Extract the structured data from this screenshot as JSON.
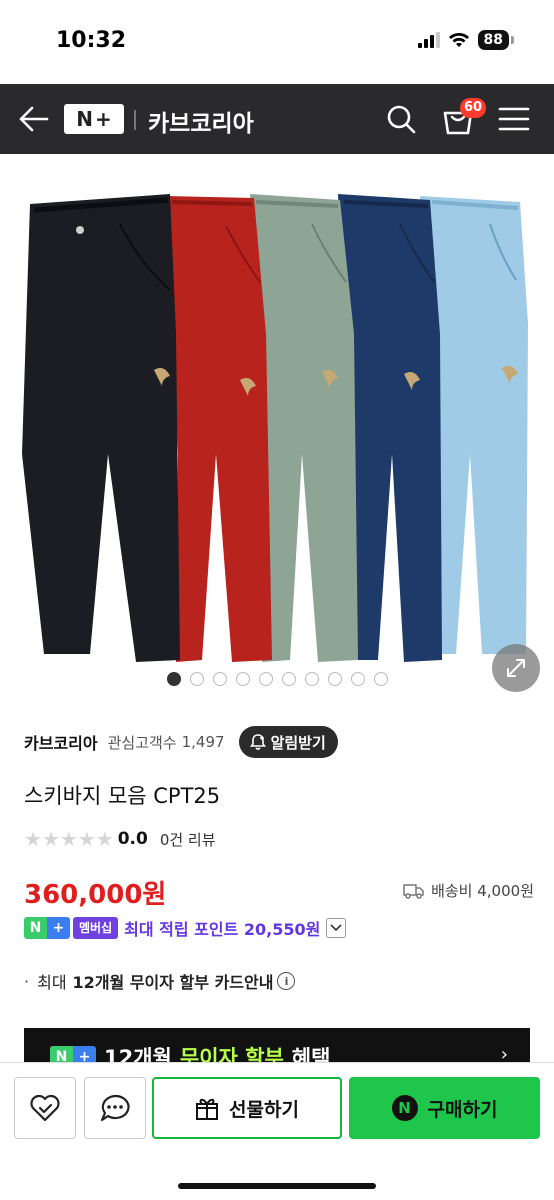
{
  "status_bar": {
    "time": "10:32",
    "battery": "88"
  },
  "header": {
    "store_title": "카브코리아",
    "logo_n": "N",
    "logo_plus": "+",
    "cart_count": "60"
  },
  "colors": {
    "header_bg": "#2a2a2c",
    "price_red": "#e01e1e",
    "naver_green": "#1ec74b",
    "member_purple": "#6f42e0",
    "pant_colors": [
      "#1b1d22",
      "#b8231d",
      "#8ea596",
      "#1e3a68",
      "#9fcbe6"
    ]
  },
  "carousel": {
    "dot_count": 10,
    "active_index": 0
  },
  "store": {
    "name": "카브코리아",
    "interest_label": "관심고객수",
    "interest_count": "1,497",
    "alert_label": "알림받기"
  },
  "product": {
    "title": "스키바지 모음 CPT25",
    "rating": "0.0",
    "review_count": "0건 리뷰",
    "price": "360,000원",
    "shipping": "배송비 4,000원"
  },
  "membership": {
    "nplus_n": "N",
    "nplus_plus": "+",
    "badge": "멤버십",
    "points_text": "최대 적립 포인트 20,550원"
  },
  "installment": {
    "prefix": "최대",
    "bold": "12개월 무이자 할부 카드안내",
    "info_glyph": "i"
  },
  "promo": {
    "text_before": "12개월",
    "highlight": "무이자 할부",
    "text_after": "혜택",
    "arrow": "›"
  },
  "bottom_bar": {
    "gift_label": "선물하기",
    "buy_label": "구매하기",
    "npay_glyph": "N"
  }
}
